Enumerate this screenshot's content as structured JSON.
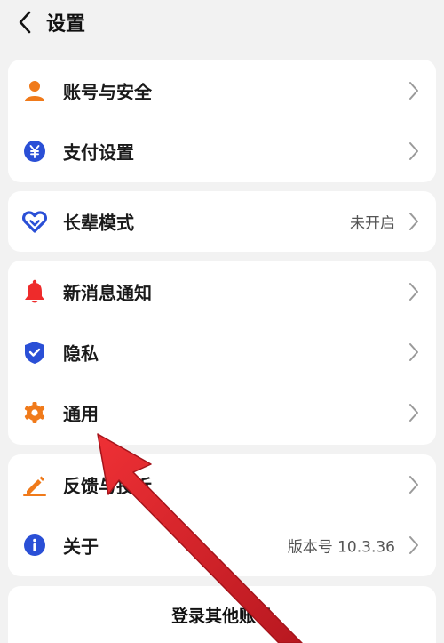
{
  "header": {
    "title": "设置"
  },
  "groups": [
    {
      "items": [
        {
          "label": "账号与安全",
          "value": ""
        },
        {
          "label": "支付设置",
          "value": ""
        }
      ]
    },
    {
      "items": [
        {
          "label": "长辈模式",
          "value": "未开启"
        }
      ]
    },
    {
      "items": [
        {
          "label": "新消息通知",
          "value": ""
        },
        {
          "label": "隐私",
          "value": ""
        },
        {
          "label": "通用",
          "value": ""
        }
      ]
    },
    {
      "items": [
        {
          "label": "反馈与投诉",
          "value": ""
        },
        {
          "label": "关于",
          "value": "版本号 10.3.36"
        }
      ]
    }
  ],
  "logout": {
    "label": "登录其他账号"
  },
  "colors": {
    "account_icon": "#f07a1a",
    "payment_icon": "#2a4fd6",
    "elder_icon": "#2a4fd6",
    "notify_icon": "#ee2b2b",
    "privacy_icon": "#2a4fd6",
    "general_icon": "#f07a1a",
    "feedback_icon": "#f07a1a",
    "about_icon": "#2a4fd6",
    "annotation_arrow": "#d8232a"
  },
  "icons": [
    "back-icon",
    "person-icon",
    "yuan-icon",
    "heart-icon",
    "bell-icon",
    "shield-icon",
    "gear-icon",
    "edit-icon",
    "info-icon",
    "chevron-right-icon"
  ]
}
